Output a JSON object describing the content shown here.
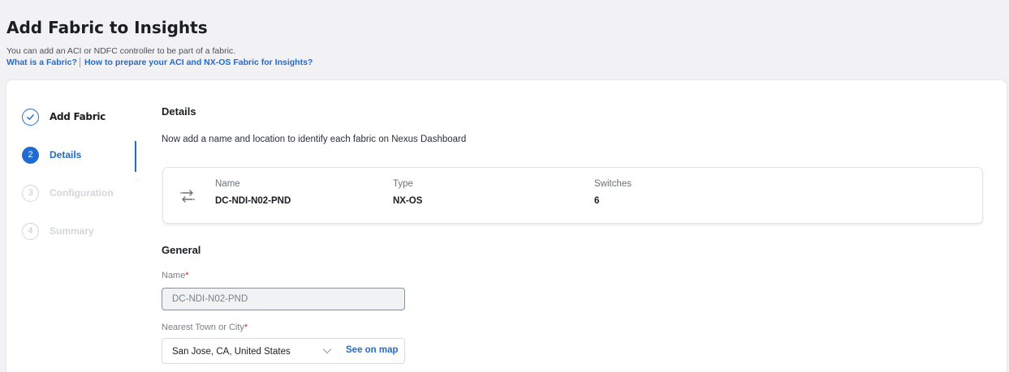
{
  "header": {
    "title": "Add Fabric to Insights",
    "subtitle": "You can add an ACI or NDFC controller to be part of a fabric.",
    "links": [
      "What is a Fabric?",
      "How to prepare your ACI and NX-OS Fabric for Insights?"
    ]
  },
  "stepper": {
    "steps": [
      {
        "number": "",
        "label": "Add Fabric",
        "state": "completed"
      },
      {
        "number": "2",
        "label": "Details",
        "state": "active"
      },
      {
        "number": "3",
        "label": "Configuration",
        "state": "pending"
      },
      {
        "number": "4",
        "label": "Summary",
        "state": "pending"
      }
    ]
  },
  "details": {
    "title": "Details",
    "description": "Now add a name and location to identify each fabric on Nexus Dashboard",
    "summary": {
      "icon": "swap-arrows-icon",
      "columns": [
        {
          "header": "Name",
          "value": "DC-NDI-N02-PND"
        },
        {
          "header": "Type",
          "value": "NX-OS"
        },
        {
          "header": "Switches",
          "value": "6"
        }
      ]
    }
  },
  "general": {
    "title": "General",
    "name_label": "Name",
    "name_value": "DC-NDI-N02-PND",
    "location_label": "Nearest Town or City",
    "location_value": "San Jose, CA, United States",
    "see_on_map": "See on map",
    "required_marker": "*"
  },
  "colors": {
    "accent": "#1f6bd0",
    "required": "#d0241b"
  }
}
